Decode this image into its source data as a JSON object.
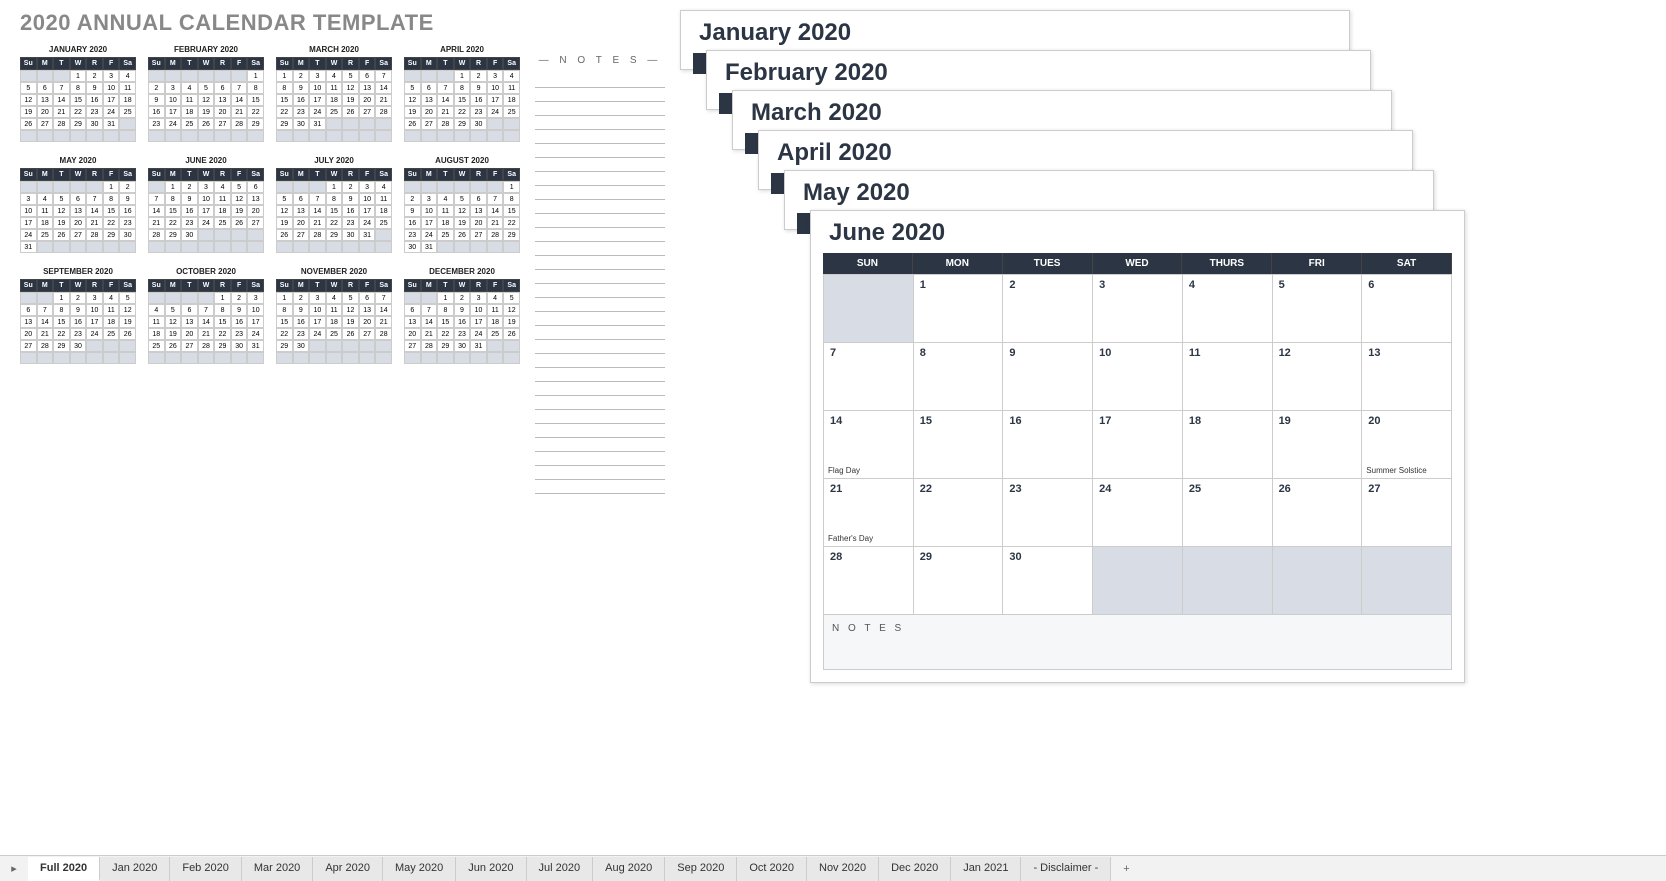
{
  "title": "2020 ANNUAL CALENDAR TEMPLATE",
  "dayHeadsShort": [
    "Su",
    "M",
    "T",
    "W",
    "R",
    "F",
    "Sa"
  ],
  "dayHeadsLong": [
    "SUN",
    "MON",
    "TUES",
    "WED",
    "THURS",
    "FRI",
    "SAT"
  ],
  "notesLabel": "— N O T E S —",
  "monthNotesLabel": "N O T E S",
  "months": [
    {
      "name": "JANUARY 2020",
      "startDay": 3,
      "days": 31
    },
    {
      "name": "FEBRUARY 2020",
      "startDay": 6,
      "days": 29
    },
    {
      "name": "MARCH 2020",
      "startDay": 0,
      "days": 31
    },
    {
      "name": "APRIL 2020",
      "startDay": 3,
      "days": 30
    },
    {
      "name": "MAY 2020",
      "startDay": 5,
      "days": 31
    },
    {
      "name": "JUNE 2020",
      "startDay": 1,
      "days": 30
    },
    {
      "name": "JULY 2020",
      "startDay": 3,
      "days": 31
    },
    {
      "name": "AUGUST 2020",
      "startDay": 6,
      "days": 31
    },
    {
      "name": "SEPTEMBER 2020",
      "startDay": 2,
      "days": 30
    },
    {
      "name": "OCTOBER 2020",
      "startDay": 4,
      "days": 31
    },
    {
      "name": "NOVEMBER 2020",
      "startDay": 0,
      "days": 30
    },
    {
      "name": "DECEMBER 2020",
      "startDay": 2,
      "days": 31
    }
  ],
  "stackedPages": [
    {
      "title": "January 2020"
    },
    {
      "title": "February 2020"
    },
    {
      "title": "March 2020"
    },
    {
      "title": "April 2020"
    },
    {
      "title": "May 2020"
    },
    {
      "title": "June 2020"
    }
  ],
  "juneGrid": {
    "startDay": 1,
    "days": 30,
    "events": {
      "14": "Flag Day",
      "20": "Summer Solstice",
      "21": "Father's Day"
    }
  },
  "tabs": [
    "Full 2020",
    "Jan 2020",
    "Feb 2020",
    "Mar 2020",
    "Apr 2020",
    "May 2020",
    "Jun 2020",
    "Jul 2020",
    "Aug 2020",
    "Sep 2020",
    "Oct 2020",
    "Nov 2020",
    "Dec 2020",
    "Jan 2021",
    "- Disclaimer -"
  ],
  "activeTab": 0
}
